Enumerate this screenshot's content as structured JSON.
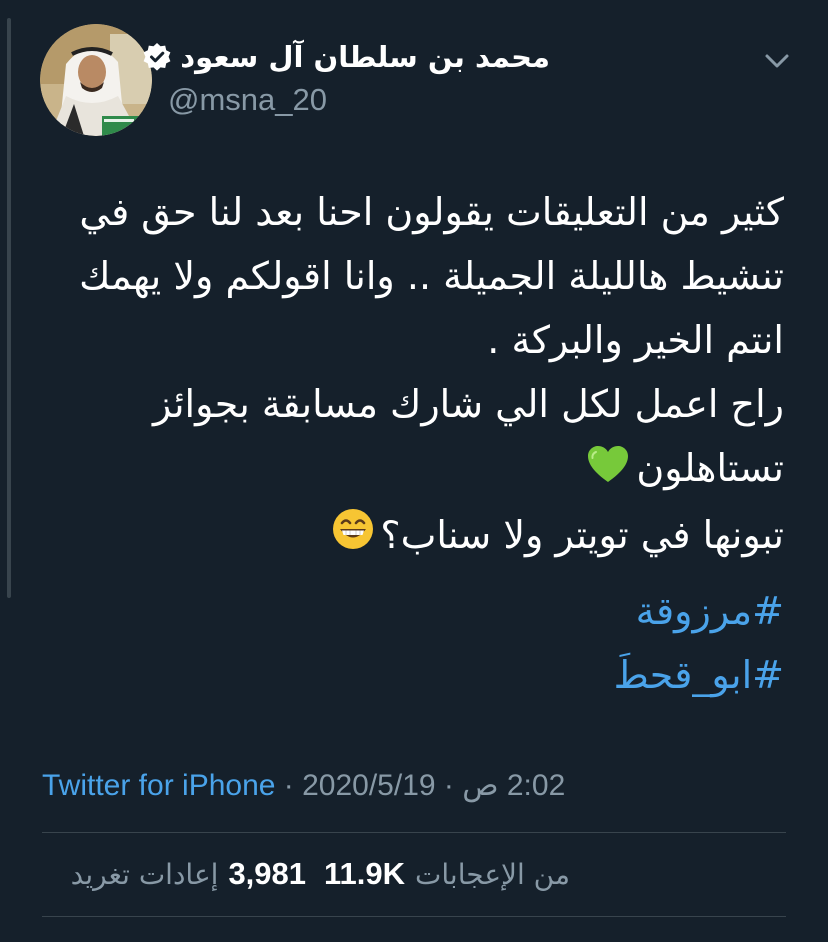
{
  "author": {
    "display_name": "محمد بن سلطان آل سعود",
    "handle": "@msna_20",
    "verified_icon": "verified-badge-icon"
  },
  "tweet": {
    "lines": [
      "كثير من التعليقات يقولون احنا بعد لنا حق في",
      "تنشيط هالليلة الجميلة .. وانا اقولكم ولا يهمك",
      "انتم الخير والبركة .",
      "راح اعمل لكل الي شارك مسابقة بجوائز",
      "تستاهلون",
      "تبونها في تويتر ولا سناب؟"
    ],
    "emojis": {
      "green_heart": "💚",
      "grin": "😁"
    },
    "hashtags": [
      "#مرزوقة",
      "#ابو_قحطَ"
    ]
  },
  "meta": {
    "source": "Twitter for iPhone",
    "separator": " · ",
    "date": "2020/5/19",
    "time": "2:02 ص"
  },
  "stats": {
    "retweets_count": "3,981",
    "retweets_label": "إعادات تغريد",
    "likes_count": "11.9K",
    "likes_label": "من الإعجابات"
  },
  "colors": {
    "background": "#15202b",
    "link": "#4aa3ea",
    "secondary_text": "#8899a6",
    "divider": "#38444d"
  }
}
